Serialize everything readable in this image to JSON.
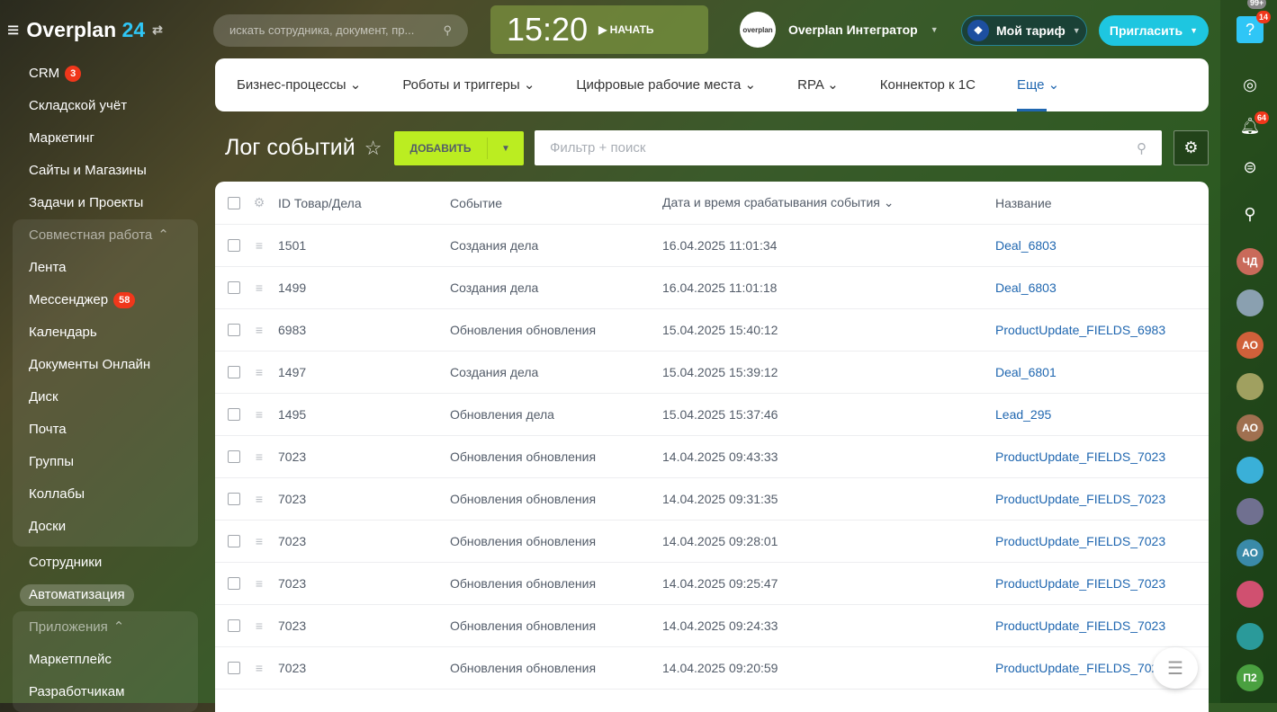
{
  "logo": {
    "name": "Overplan",
    "num": "24"
  },
  "sidebar": {
    "items": [
      {
        "label": "CRM",
        "badge": "3"
      },
      {
        "label": "Складской учёт"
      },
      {
        "label": "Маркетинг"
      },
      {
        "label": "Сайты и Магазины"
      },
      {
        "label": "Задачи и Проекты"
      }
    ],
    "group": {
      "label": "Совместная работа",
      "items": [
        {
          "label": "Лента"
        },
        {
          "label": "Мессенджер",
          "badge": "58"
        },
        {
          "label": "Календарь"
        },
        {
          "label": "Документы Онлайн"
        },
        {
          "label": "Диск"
        },
        {
          "label": "Почта"
        },
        {
          "label": "Группы"
        },
        {
          "label": "Коллабы"
        },
        {
          "label": "Доски"
        }
      ]
    },
    "after": [
      {
        "label": "Сотрудники"
      },
      {
        "label": "Автоматизация"
      }
    ],
    "group2": {
      "label": "Приложения",
      "items": [
        {
          "label": "Маркетплейс"
        },
        {
          "label": "Разработчикам"
        }
      ]
    }
  },
  "header": {
    "search_placeholder": "искать сотрудника, документ, пр...",
    "time": "15:20",
    "start": "НАЧАТЬ",
    "org": "Overplan Интегратор",
    "org_logo": "overplan",
    "tariff": "Мой тариф",
    "invite": "Пригласить",
    "help_badge": "14"
  },
  "nav": {
    "tabs": [
      "Бизнес-процессы",
      "Роботы и триггеры",
      "Цифровые рабочие места",
      "RPA",
      "Коннектор к 1С",
      "Еще"
    ]
  },
  "page": {
    "title": "Лог событий",
    "add": "ДОБАВИТЬ",
    "filter_placeholder": "Фильтр + поиск"
  },
  "table": {
    "columns": [
      "ID Товар/Дела",
      "Событие",
      "Дата и время срабатывания события",
      "Название"
    ],
    "rows": [
      [
        "1501",
        "Создания дела",
        "16.04.2025 11:01:34",
        "Deal_6803"
      ],
      [
        "1499",
        "Создания дела",
        "16.04.2025 11:01:18",
        "Deal_6803"
      ],
      [
        "6983",
        "Обновления обновления",
        "15.04.2025 15:40:12",
        "ProductUpdate_FIELDS_6983"
      ],
      [
        "1497",
        "Создания дела",
        "15.04.2025 15:39:12",
        "Deal_6801"
      ],
      [
        "1495",
        "Обновления дела",
        "15.04.2025 15:37:46",
        "Lead_295"
      ],
      [
        "7023",
        "Обновления обновления",
        "14.04.2025 09:43:33",
        "ProductUpdate_FIELDS_7023"
      ],
      [
        "7023",
        "Обновления обновления",
        "14.04.2025 09:31:35",
        "ProductUpdate_FIELDS_7023"
      ],
      [
        "7023",
        "Обновления обновления",
        "14.04.2025 09:28:01",
        "ProductUpdate_FIELDS_7023"
      ],
      [
        "7023",
        "Обновления обновления",
        "14.04.2025 09:25:47",
        "ProductUpdate_FIELDS_7023"
      ],
      [
        "7023",
        "Обновления обновления",
        "14.04.2025 09:24:33",
        "ProductUpdate_FIELDS_7023"
      ],
      [
        "7023",
        "Обновления обновления",
        "14.04.2025 09:20:59",
        "ProductUpdate_FIELDS_7023"
      ]
    ]
  },
  "right": {
    "notif_badge": "64",
    "chat_badge": "99+",
    "avatars": [
      {
        "label": "ЧД",
        "color": "#c96a5a"
      },
      {
        "label": "",
        "color": "#8aa0b0"
      },
      {
        "label": "АО",
        "color": "#d0603a"
      },
      {
        "label": "",
        "color": "#a0a060"
      },
      {
        "label": "АО",
        "color": "#a07050"
      },
      {
        "label": "",
        "color": "#3ab0d8"
      },
      {
        "label": "",
        "color": "#707090"
      },
      {
        "label": "АО",
        "color": "#3a8aa8"
      },
      {
        "label": "",
        "color": "#d05070"
      },
      {
        "label": "",
        "color": "#2a9a9a"
      },
      {
        "label": "П2",
        "color": "#4aa040"
      }
    ]
  }
}
